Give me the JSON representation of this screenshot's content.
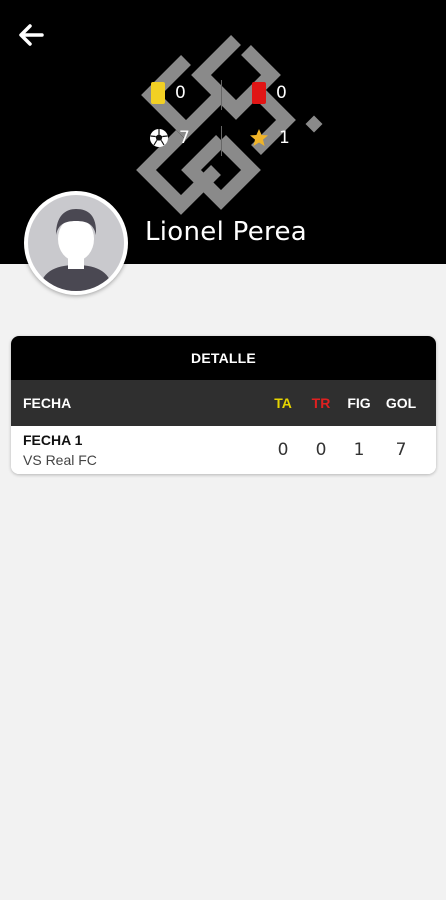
{
  "header": {
    "back_icon": "arrow-left-icon",
    "stats": {
      "yellow_cards": "0",
      "red_cards": "0",
      "goals": "7",
      "mvp": "1"
    },
    "player_name": "Lionel Perea"
  },
  "colors": {
    "header_bg": "#000000",
    "yellow_card": "#f2d024",
    "red_card": "#e01515",
    "star": "#f0b429",
    "ta_header": "#e6d400",
    "tr_header": "#e02020"
  },
  "detail": {
    "title": "DETALLE",
    "columns": {
      "fecha": "FECHA",
      "ta": "TA",
      "tr": "TR",
      "fig": "FIG",
      "gol": "GOL"
    },
    "rows": [
      {
        "fecha": "FECHA 1",
        "opponent": "VS Real FC",
        "ta": "0",
        "tr": "0",
        "fig": "1",
        "gol": "7"
      }
    ]
  }
}
